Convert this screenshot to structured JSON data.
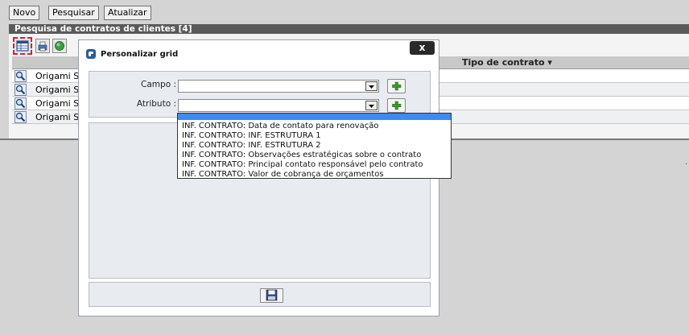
{
  "toolbar": {
    "novo_label": "Novo",
    "pesquisar_label": "Pesquisar",
    "atualizar_label": "Atualizar"
  },
  "panel": {
    "title": "Pesquisa de contratos de clientes [4]",
    "column_tipo": "Tipo de contrato",
    "rows": [
      "Origami S/",
      "Origami S/",
      "Origami S/",
      "Origami S/"
    ]
  },
  "dialog": {
    "title": "Personalizar grid",
    "close_label": "x",
    "campo_label": "Campo :",
    "atributo_label": "Atributo :",
    "campo_value": "",
    "atributo_value": ""
  },
  "dropdown": {
    "options": [
      "INF. CONTRATO: Data de contato para renovação",
      "INF. CONTRATO: INF. ESTRUTURA 1",
      "INF. CONTRATO: INF. ESTRUTURA 2",
      "INF. CONTRATO: Observações estratégicas sobre o contrato",
      "INF. CONTRATO: Principal contato responsável pelo contrato",
      "INF. CONTRATO: Valor de cobrança de orçamentos"
    ]
  },
  "side_mark": ".",
  "colors": {
    "panel_bar": "#5a5a5a",
    "dropdown_selected": "#3b8cf0",
    "close_button": "#2a2a2a",
    "plus_green": "#3aa028"
  },
  "icons": {
    "grid_config": "grid-icon",
    "print": "print-icon",
    "export": "globe-icon",
    "row_view": "magnifier-icon",
    "add": "plus-icon",
    "save": "floppy-disk-icon",
    "logo": "app-logo-icon"
  }
}
